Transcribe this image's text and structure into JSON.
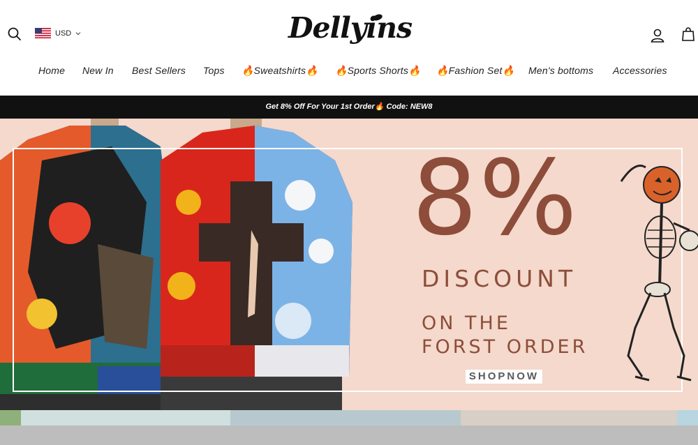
{
  "header": {
    "logo": "Dellyins",
    "currency": "USD",
    "icons": {
      "search": "search-icon",
      "flag": "us-flag-icon",
      "chevron": "chevron-down-icon",
      "account": "user-icon",
      "cart": "cart-icon"
    }
  },
  "nav": {
    "items": [
      {
        "label": "Home"
      },
      {
        "label": "New In"
      },
      {
        "label": "Best Sellers"
      },
      {
        "label": "Tops"
      },
      {
        "label": "🔥Sweatshirts🔥"
      },
      {
        "label": "🔥Sports Shorts🔥"
      },
      {
        "label": "🔥Fashion Set🔥"
      },
      {
        "label": "Men's bottoms"
      },
      {
        "label": "Accessories"
      }
    ]
  },
  "promo": {
    "text": "Get 8% Off For Your 1st Order🔥 Code: NEW8"
  },
  "hero": {
    "big_text": "8%",
    "discount_text": "DISCOUNT",
    "line1": "ON THE",
    "line2": "FORST ORDER",
    "cta": "SHOPNOW",
    "colors": {
      "background": "#f4d9cc",
      "text": "#8d4d3a"
    }
  }
}
